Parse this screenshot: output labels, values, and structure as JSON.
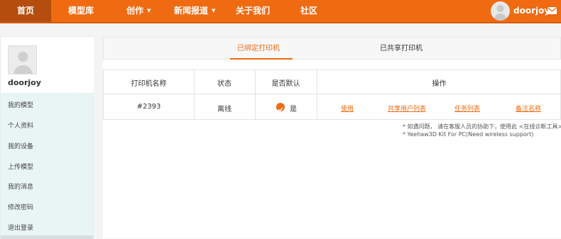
{
  "nav": {
    "home": "首页",
    "models": "模型库",
    "create": "创作",
    "news": "新闻报道",
    "about": "关于我们",
    "community": "社区",
    "username": "doorjoy"
  },
  "sidebar": {
    "username": "doorjoy",
    "items": [
      "我的模型",
      "个人资料",
      "我的设备",
      "上传模型",
      "我的消息",
      "修改密码",
      "退出登录"
    ]
  },
  "tabs": [
    "已绑定打印机",
    "已共享打印机"
  ],
  "table": {
    "headers": [
      "打印机名称",
      "状态",
      "是否默认",
      "操作"
    ],
    "row": {
      "name": "#2393",
      "status": "离线",
      "default": "是",
      "actions": [
        "使用",
        "共享用户列表",
        "任务列表",
        "备注名称"
      ]
    }
  },
  "notes": [
    "* 如遇问题， 请在客服人员的协助下，使用此 <在线诊断工具>",
    "* Yeehaw3D Kit For PC(Need wireless support)"
  ],
  "colors": {
    "brand": "#ef6a10",
    "active_nav": "#b44d0d"
  }
}
